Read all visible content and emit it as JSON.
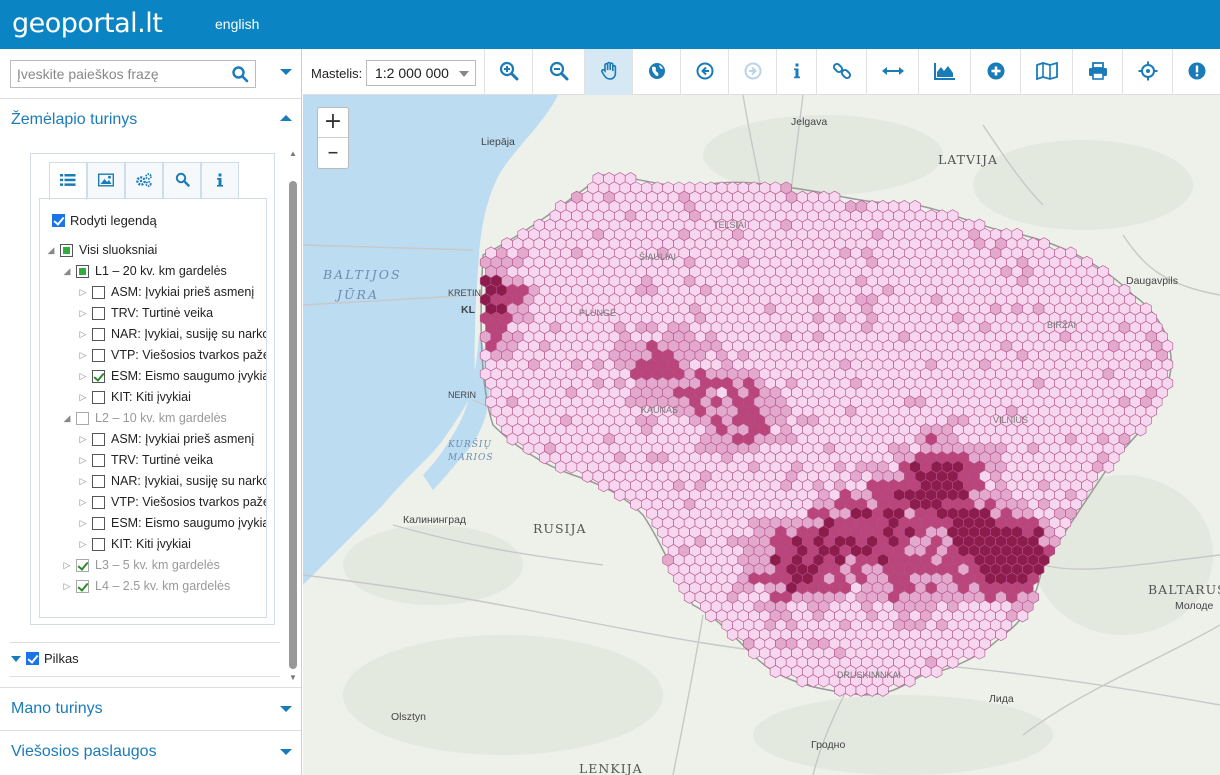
{
  "header": {
    "logo": "geoportal.lt",
    "language_link": "english"
  },
  "sidebar": {
    "search": {
      "placeholder": "Įveskite paieškos frazę",
      "value": ""
    },
    "map_content_panel": {
      "title": "Žemėlapio turinys",
      "tabs": [
        {
          "name": "legend-list",
          "icon": "list-icon"
        },
        {
          "name": "image",
          "icon": "image-icon"
        },
        {
          "name": "settings",
          "icon": "gears-icon"
        },
        {
          "name": "search",
          "icon": "magnifier-icon"
        },
        {
          "name": "info",
          "icon": "info-icon"
        }
      ],
      "show_legend": {
        "label": "Rodyti legendą",
        "checked": true
      },
      "tree": {
        "root": "Visi sluoksniai",
        "groups": [
          {
            "label": "L1 – 20 kv. km gardelės",
            "state": "partial",
            "expanded": true,
            "items": [
              {
                "label": "ASM: Įvykiai prieš asmenį",
                "checked": false
              },
              {
                "label": "TRV: Turtinė veika",
                "checked": false
              },
              {
                "label": "NAR: Įvykiai, susiję su narkotikais",
                "checked": false
              },
              {
                "label": "VTP: Viešosios tvarkos pažeidimai",
                "checked": false
              },
              {
                "label": "ESM: Eismo saugumo įvykiai",
                "checked": true
              },
              {
                "label": "KIT: Kiti įvykiai",
                "checked": false
              }
            ]
          },
          {
            "label": "L2 – 10 kv. km gardelės",
            "state": "unchecked",
            "expanded": true,
            "items": [
              {
                "label": "ASM: Įvykiai prieš asmenį",
                "checked": false
              },
              {
                "label": "TRV: Turtinė veika",
                "checked": false
              },
              {
                "label": "NAR: Įvykiai, susiję su narkotikais",
                "checked": false
              },
              {
                "label": "VTP: Viešosios tvarkos pažeidimai",
                "checked": false
              },
              {
                "label": "ESM: Eismo saugumo įvykiai",
                "checked": false
              },
              {
                "label": "KIT: Kiti įvykiai",
                "checked": false
              }
            ]
          },
          {
            "label": "L3 – 5 kv. km gardelės",
            "state": "checked",
            "expanded": false
          },
          {
            "label": "L4 – 2.5 kv. km gardelės",
            "state": "checked",
            "expanded": false
          }
        ]
      },
      "basemap": {
        "label": "Pilkas",
        "checked": true
      }
    },
    "my_content_panel": {
      "title": "Mano turinys"
    },
    "public_services_panel": {
      "title": "Viešosios paslaugos"
    }
  },
  "toolbar": {
    "scale_label": "Mastelis:",
    "scale_value": "1:2 000 000",
    "tools": [
      "zoom-in-icon",
      "zoom-out-icon",
      "pan-hand-icon",
      "globe-icon",
      "back-icon",
      "forward-icon",
      "info-icon",
      "link-icon",
      "measure-icon",
      "profile-icon",
      "add-icon",
      "map-icon",
      "print-icon",
      "locate-icon",
      "alert-icon"
    ]
  },
  "map": {
    "zoom_in": "+",
    "zoom_out": "–",
    "labels": {
      "jelgava": "Jelgava",
      "liepaja": "Liepāja",
      "latvija": "LATVIJA",
      "baltijos": "BALTIJOS",
      "jura": "JŪRA",
      "kretinga": "KRETIN",
      "klaipeda": "KL",
      "daugavpils": "Daugavpils",
      "nerin": "NERIN",
      "kursiu": "KURŠIŲ",
      "marios": "MARIOS",
      "kaliningrad": "Калининград",
      "rusija": "RUSIJA",
      "baltarus": "BALTARUS",
      "molodechno": "Молоде",
      "lida": "Лида",
      "olsztyn": "Olsztyn",
      "grodno": "Гродно",
      "lenkija": "LENKIJA",
      "siauliai": "ŠIAULIAI",
      "telsiai": "TELŠIAI",
      "plunge": "PLUNGĖ",
      "kaunas": "KAUNAS",
      "vilnius": "VILNIUS",
      "birzai": "BIRŽAI",
      "druskininkai": "DRUSKININKAI"
    },
    "colors": {
      "water": "#bcdcf2",
      "land": "#eef0ea",
      "hex_light": "#f6d7ef",
      "hex_mid": "#e3a9cd",
      "hex_dark": "#b9457a",
      "hex_darkest": "#8c1c4b",
      "hex_stroke": "#b5508a"
    }
  }
}
